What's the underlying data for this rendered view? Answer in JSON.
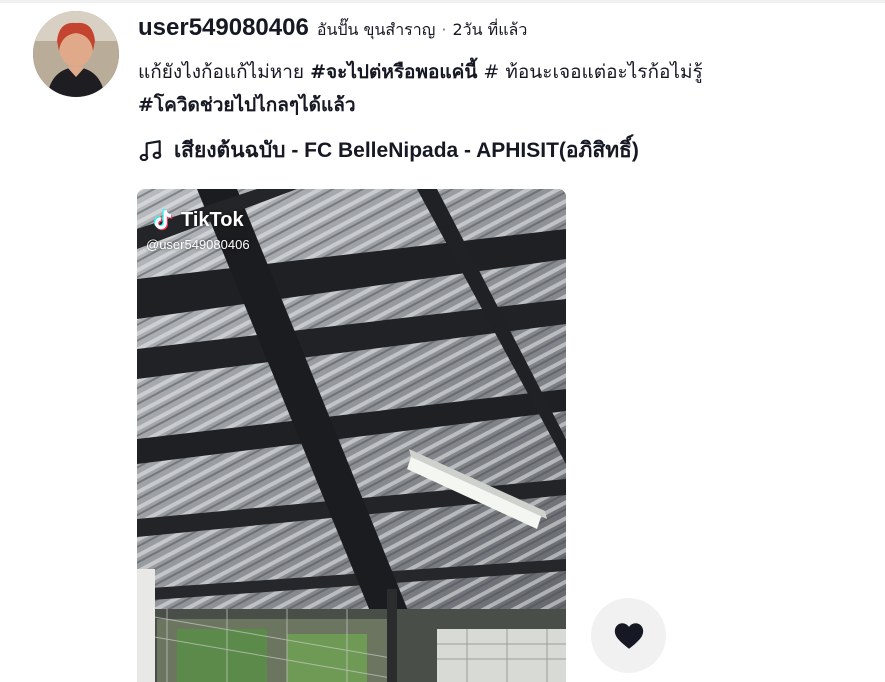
{
  "post": {
    "username": "user549080406",
    "nickname": "อันปั๊น ขุนสำราญ",
    "separator": "·",
    "time": "2วัน ที่แล้ว",
    "caption": {
      "text1": "แก้ยังไงก้อแก้ไม่หาย ",
      "hashtag1": "#จะไปต่หรือพอแค่นี้",
      "text2": " # ท้อนะเจอแต่อะไรก้อไม่รู้",
      "hashtag2": "#โควิดช่วยไปไกลๆได้แล้ว"
    },
    "music": {
      "icon": "music-note-icon",
      "title": "เสียงต้นฉบับ - FC BelleNipada - APHISIT(อภิสิทธิ์)"
    }
  },
  "video": {
    "watermark_brand": "TikTok",
    "watermark_user": "@user549080406"
  },
  "actions": {
    "like_icon": "heart-icon"
  },
  "colors": {
    "text": "#161823",
    "button_bg": "#f1f1f2",
    "secondary": "#75767d"
  }
}
